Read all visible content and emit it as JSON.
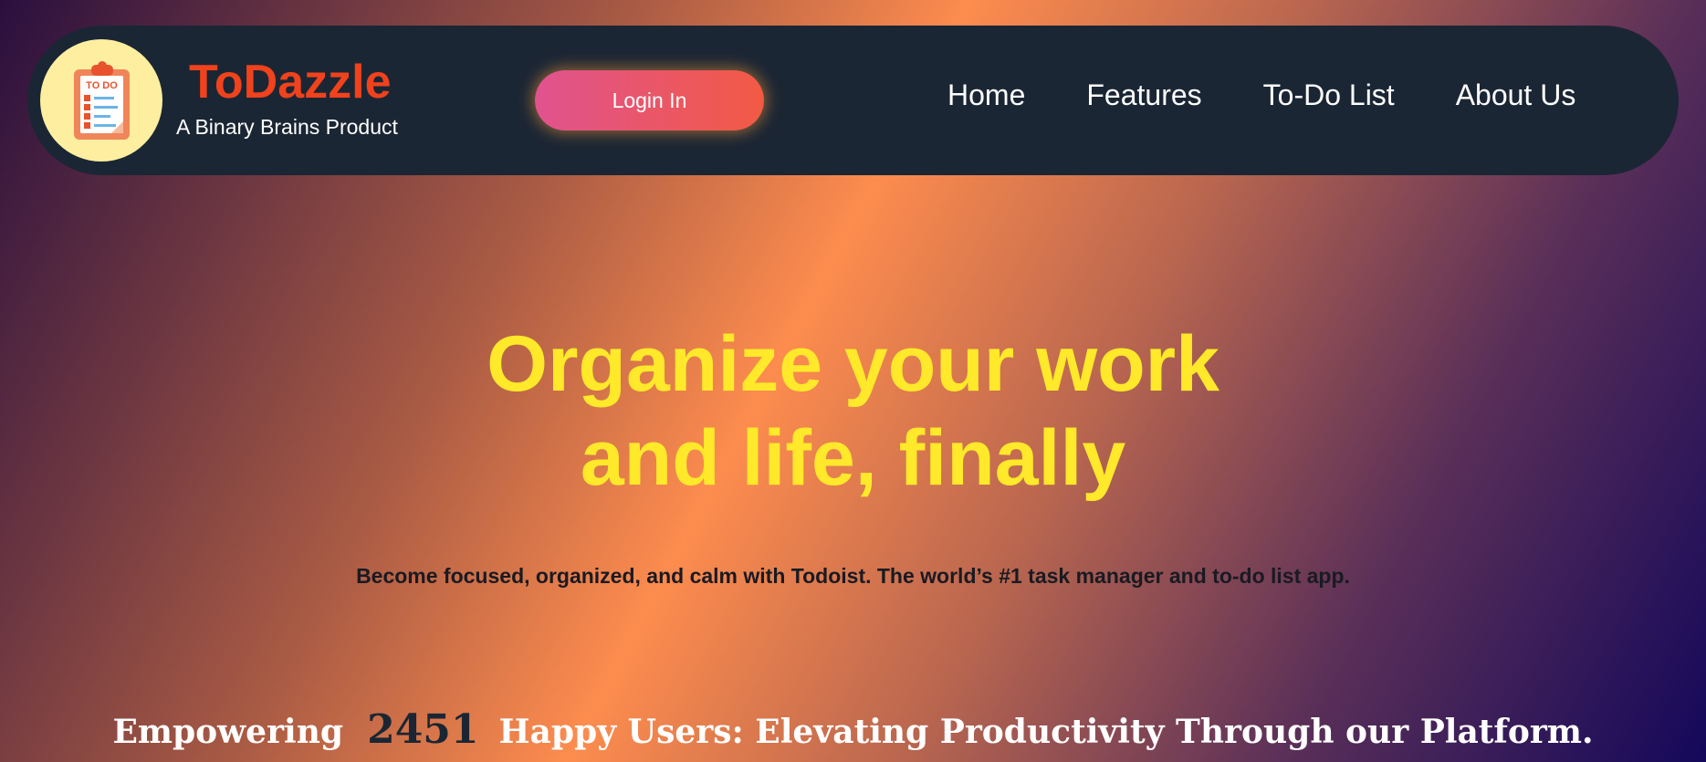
{
  "brand": {
    "name": "ToDazzle",
    "tagline": "A Binary Brains Product",
    "logo_icon": "todo-clipboard-icon",
    "logo_text": "TO DO"
  },
  "header": {
    "login_label": "Login In",
    "nav": [
      {
        "label": "Home"
      },
      {
        "label": "Features"
      },
      {
        "label": "To-Do List"
      },
      {
        "label": "About Us"
      }
    ]
  },
  "hero": {
    "title_line1": "Organize your work",
    "title_line2": "and life, finally",
    "subtitle": "Become focused, organized, and calm with Todoist. The world’s #1 task manager and to-do list app."
  },
  "stats": {
    "prefix": "Empowering",
    "count": "2451",
    "suffix": "Happy Users: Elevating Productivity Through our Platform."
  },
  "colors": {
    "navbar": "#1b2634",
    "brand": "#f0421c",
    "headline": "#ffe92a",
    "login_gradient_start": "#e0538f",
    "login_gradient_end": "#f25a44"
  }
}
